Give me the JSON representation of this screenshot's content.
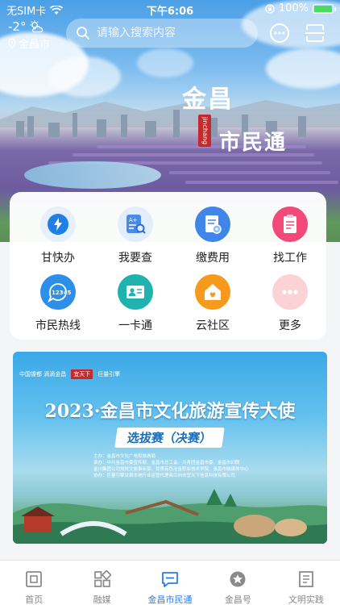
{
  "status_bar": {
    "carrier": "无SIM卡",
    "time": "下午6:06",
    "battery": "100%"
  },
  "weather": {
    "temperature": "-2°",
    "city": "金昌市"
  },
  "search": {
    "placeholder": "请输入搜索内容"
  },
  "brand": {
    "line1": "金昌",
    "line2": "市民通",
    "seal": "jinchang"
  },
  "services": [
    {
      "label": "甘快办",
      "icon": "lightning-icon",
      "color": "#1e7fe8"
    },
    {
      "label": "我要查",
      "icon": "search-document-icon",
      "color": "#4a8be6"
    },
    {
      "label": "缴费用",
      "icon": "bill-icon",
      "color": "#3f86e8"
    },
    {
      "label": "找工作",
      "icon": "clipboard-icon",
      "color": "#f0497a"
    },
    {
      "label": "市民热线",
      "icon": "hotline-12345-icon",
      "color": "#2e8fe8"
    },
    {
      "label": "一卡通",
      "icon": "id-card-icon",
      "color": "#1fb3b0"
    },
    {
      "label": "云社区",
      "icon": "home-heart-icon",
      "color": "#f79a1c"
    },
    {
      "label": "更多",
      "icon": "more-icon",
      "color": "#f6a0a8"
    }
  ],
  "banner": {
    "logos": [
      "中国镍都 滴滴金昌",
      "宜天下",
      "巨量引擎"
    ],
    "title": "2023·金昌市文化旅游宣传大使",
    "subtitle": "选拔赛（决赛）",
    "orgs": [
      "主办：金昌市文化广电和旅游局",
      "承办：中共金昌市委宣传部、金昌市总工会、共青团金昌市委、金昌市妇联",
      "金川集团公司党校文旅事业部、甘肃有色冶金职业技术学院、金昌市融媒体中心",
      "协办：巨量引擎甘肃本地行业运营代理商兰州市宜天下信息科技有限公司"
    ]
  },
  "tabs": [
    {
      "label": "首页",
      "icon": "home-frame-icon",
      "active": false
    },
    {
      "label": "融媒",
      "icon": "grid-icon",
      "active": false
    },
    {
      "label": "金昌市民通",
      "icon": "chat-bubble-icon",
      "active": true
    },
    {
      "label": "金昌号",
      "icon": "star-icon",
      "active": false
    },
    {
      "label": "文明实践",
      "icon": "document-icon",
      "active": false
    }
  ]
}
